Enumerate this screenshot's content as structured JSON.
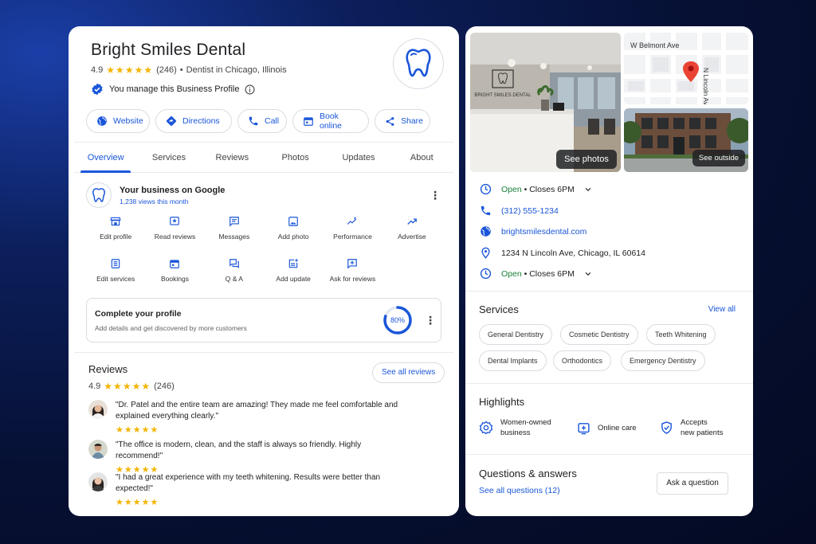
{
  "business": {
    "name": "Bright Smiles Dental",
    "rating": "4.9",
    "stars": "★★★★★",
    "review_count": "(246)",
    "separator": "•",
    "category": "Dentist in Chicago, Illinois",
    "manage_text": "You manage this Business Profile"
  },
  "actions": [
    {
      "label": "Website",
      "icon": "globe-icon"
    },
    {
      "label": "Directions",
      "icon": "directions-icon"
    },
    {
      "label": "Call",
      "icon": "phone-icon"
    },
    {
      "label": "Book online",
      "icon": "calendar-icon"
    },
    {
      "label": "Share",
      "icon": "share-icon"
    }
  ],
  "tabs": [
    "Overview",
    "Services",
    "Reviews",
    "Photos",
    "Updates",
    "About"
  ],
  "your_business": {
    "title": "Your business on Google",
    "views": "1,238 views this month"
  },
  "tools": [
    {
      "label": "Edit profile",
      "icon": "store-icon"
    },
    {
      "label": "Read reviews",
      "icon": "star-box-icon"
    },
    {
      "label": "Messages",
      "icon": "message-icon"
    },
    {
      "label": "Add photo",
      "icon": "image-icon"
    },
    {
      "label": "Performance",
      "icon": "sparkle-chart-icon"
    },
    {
      "label": "Advertise",
      "icon": "trend-up-icon"
    },
    {
      "label": "Edit services",
      "icon": "list-icon"
    },
    {
      "label": "Bookings",
      "icon": "calendar-icon"
    },
    {
      "label": "Q & A",
      "icon": "qa-icon"
    },
    {
      "label": "Add update",
      "icon": "post-add-icon"
    },
    {
      "label": "Ask for reviews",
      "icon": "review-request-icon"
    }
  ],
  "complete_profile": {
    "title": "Complete your profile",
    "subtitle": "Add details and get discovered by more customers",
    "percent_label": "80%",
    "percent": 0.8
  },
  "reviews": {
    "heading": "Reviews",
    "rating": "4.9",
    "stars": "★★★★★",
    "count": "(246)",
    "see_all": "See all reviews",
    "items": [
      {
        "text": "\"Dr. Patel and the entire team are amazing! They made me feel comfortable and explained everything clearly.\"",
        "stars": "★★★★★"
      },
      {
        "text": "\"The office is modern, clean, and the staff is always so friendly. Highly recommend!\"",
        "stars": "★★★★★"
      },
      {
        "text": "\"I had a great experience with my teeth whitening. Results were better than expected!\"",
        "stars": "★★★★★"
      }
    ]
  },
  "photos": {
    "reception_sign": "BRIGHT SMILES DENTAL",
    "see_photos": "See photos",
    "see_outside": "See outside",
    "map_street_h": "W Belmont Ave",
    "map_street_v": "N Lincoln Ave"
  },
  "info": {
    "status": "Open",
    "closes": "Closes 6PM",
    "dot": "•",
    "phone": "(312) 555-1234",
    "website": "brightsmilesdental.com",
    "address": "1234 N Lincoln Ave, Chicago, IL 60614"
  },
  "services": {
    "heading": "Services",
    "view_all": "View all",
    "items": [
      "General Dentistry",
      "Cosmetic Dentistry",
      "Teeth Whitening",
      "Dental Implants",
      "Orthodontics",
      "Emergency Dentistry"
    ]
  },
  "highlights": {
    "heading": "Highlights",
    "items": [
      {
        "line1": "Women-owned",
        "line2": "business",
        "icon": "badge-icon"
      },
      {
        "line1": "Online care",
        "line2": "",
        "icon": "medical-plus-icon"
      },
      {
        "line1": "Accepts",
        "line2": "new patients",
        "icon": "shield-check-icon"
      }
    ]
  },
  "qa": {
    "heading": "Questions & answers",
    "see_all": "See all questions (12)",
    "ask": "Ask a question"
  },
  "colors": {
    "accent": "#1a56d9",
    "star": "#f4b400",
    "open": "#188038",
    "pin": "#ea4335"
  }
}
